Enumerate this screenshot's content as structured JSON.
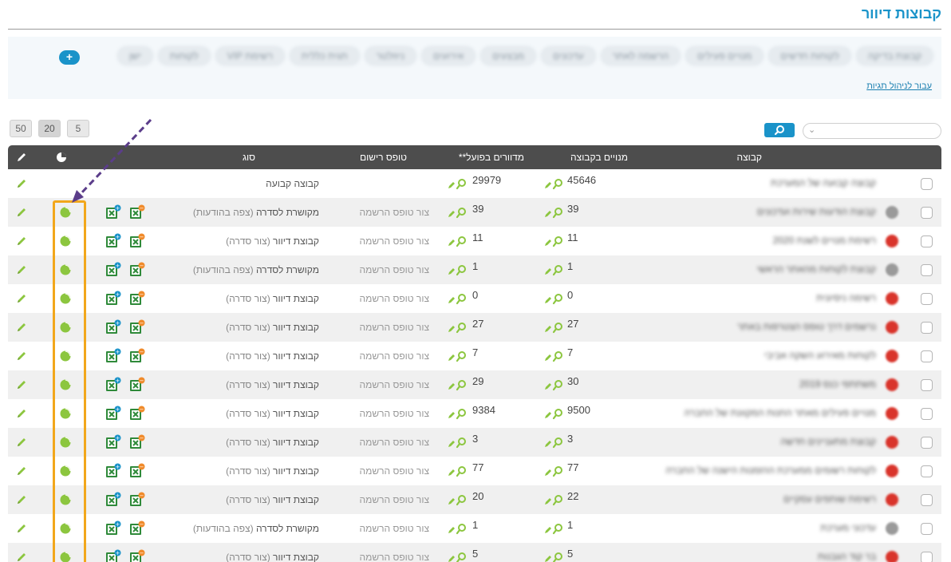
{
  "page": {
    "title": "קבוצות דיוור"
  },
  "tags": {
    "manage_link": "עבור לניהול תגיות",
    "add_label": "+",
    "chips": [
      "קבוצת בדיקה",
      "לקוחות חדשים",
      "מנויים פעילים",
      "הרשמה לאתר",
      "עדכונים",
      "מבצעים",
      "אירועים",
      "ניוזלטר",
      "תגית כללית",
      "רשימת VIP",
      "לקוחות",
      "ישן"
    ]
  },
  "pagination": {
    "sizes": [
      "50",
      "20",
      "5"
    ],
    "active": "20"
  },
  "search": {
    "button_icon": "search-icon"
  },
  "columns": {
    "group": "קבוצה",
    "subscribers": "מנויים בקבוצה",
    "mailed": "מדוורים בפועל**",
    "reg_form": "טופס רישום",
    "type": "סוג",
    "stats_icon": "pie-chart-icon",
    "edit_icon": "pencil-icon"
  },
  "colors": {
    "accent": "#1a93c9",
    "green": "#8cc63f",
    "highlight": "#f2a71b",
    "arrow": "#5b3d8a",
    "header": "#4d4d4d"
  },
  "rows": [
    {
      "name": "קבוצה קבועה של המערכת",
      "dot": "none",
      "subscribers": "45646",
      "mailed": "29979",
      "reg_form": "",
      "type_main": "קבוצה קבועה",
      "type_sub": "",
      "fixed": true
    },
    {
      "name": "קבוצת הודעות שירות ועדכונים",
      "dot": "#9a9a9a",
      "subscribers": "39",
      "mailed": "39",
      "reg_form": "צור טופס הרשמה",
      "type_main": "מקושרת לסדרה",
      "type_sub": "(צפה בהודעות)",
      "fixed": false
    },
    {
      "name": "רשימת מנויים לשנת 2020",
      "dot": "#d9342b",
      "subscribers": "11",
      "mailed": "11",
      "reg_form": "צור טופס הרשמה",
      "type_main": "קבוצת דיוור",
      "type_sub": "(צור סדרה)",
      "fixed": false
    },
    {
      "name": "קבוצת לקוחות מהאתר הראשי",
      "dot": "#9a9a9a",
      "subscribers": "1",
      "mailed": "1",
      "reg_form": "צור טופס הרשמה",
      "type_main": "מקושרת לסדרה",
      "type_sub": "(צפה בהודעות)",
      "fixed": false
    },
    {
      "name": "רשימה ניסיונית",
      "dot": "#d9342b",
      "subscribers": "0",
      "mailed": "0",
      "reg_form": "צור טופס הרשמה",
      "type_main": "קבוצת דיוור",
      "type_sub": "(צור סדרה)",
      "fixed": false
    },
    {
      "name": "נרשמים דרך טופס הצטרפות באתר",
      "dot": "#d9342b",
      "subscribers": "27",
      "mailed": "27",
      "reg_form": "צור טופס הרשמה",
      "type_main": "קבוצת דיוור",
      "type_sub": "(צור סדרה)",
      "fixed": false
    },
    {
      "name": "לקוחות מאירוע השקה אביבי",
      "dot": "#d9342b",
      "subscribers": "7",
      "mailed": "7",
      "reg_form": "צור טופס הרשמה",
      "type_main": "קבוצת דיוור",
      "type_sub": "(צור סדרה)",
      "fixed": false
    },
    {
      "name": "משתתפי כנס 2019",
      "dot": "#d9342b",
      "subscribers": "30",
      "mailed": "29",
      "reg_form": "צור טופס הרשמה",
      "type_main": "קבוצת דיוור",
      "type_sub": "(צור סדרה)",
      "fixed": false
    },
    {
      "name": "מנויים פעילים מאתר החנות המקוונת של החברה",
      "dot": "#d9342b",
      "subscribers": "9500",
      "mailed": "9384",
      "reg_form": "צור טופס הרשמה",
      "type_main": "קבוצת דיוור",
      "type_sub": "(צור סדרה)",
      "fixed": false
    },
    {
      "name": "קבוצת מתעניינים חדשה",
      "dot": "#d9342b",
      "subscribers": "3",
      "mailed": "3",
      "reg_form": "צור טופס הרשמה",
      "type_main": "קבוצת דיוור",
      "type_sub": "(צור סדרה)",
      "fixed": false
    },
    {
      "name": "לקוחות רשומים ממערכת ההזמנות הישנה של החברה",
      "dot": "#d9342b",
      "subscribers": "77",
      "mailed": "77",
      "reg_form": "צור טופס הרשמה",
      "type_main": "קבוצת דיוור",
      "type_sub": "(צור סדרה)",
      "fixed": false
    },
    {
      "name": "רשימת שותפים עסקיים",
      "dot": "#d9342b",
      "subscribers": "22",
      "mailed": "20",
      "reg_form": "צור טופס הרשמה",
      "type_main": "קבוצת דיוור",
      "type_sub": "(צור סדרה)",
      "fixed": false
    },
    {
      "name": "עדכוני מערכת",
      "dot": "#9a9a9a",
      "subscribers": "1",
      "mailed": "1",
      "reg_form": "צור טופס הרשמה",
      "type_main": "מקושרת לסדרה",
      "type_sub": "(צפה בהודעות)",
      "fixed": false
    },
    {
      "name": "בר קוד הגבנות",
      "dot": "#d9342b",
      "subscribers": "5",
      "mailed": "5",
      "reg_form": "צור טופס הרשמה",
      "type_main": "קבוצת דיוור",
      "type_sub": "(צור סדרה)",
      "fixed": false
    }
  ]
}
